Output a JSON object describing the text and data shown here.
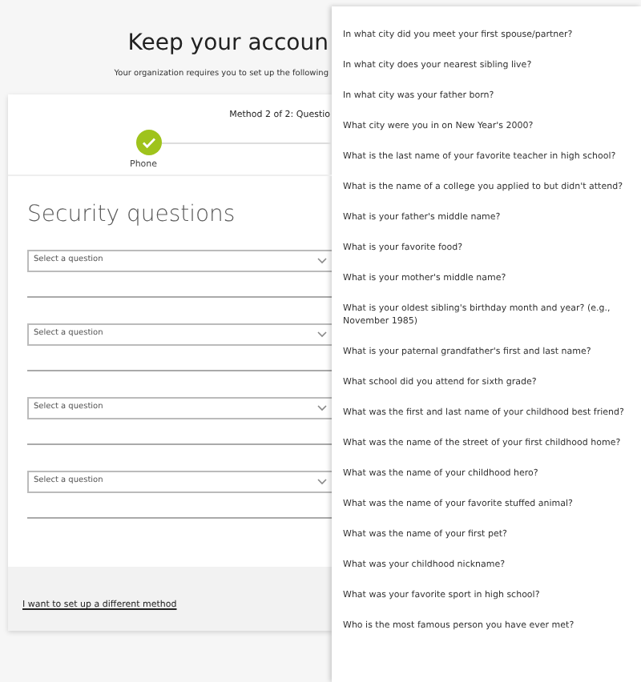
{
  "header": {
    "title": "Keep your accoun",
    "subtitle": "Your organization requires you to set up the following"
  },
  "card": {
    "progress": "Method 2 of 2: Questio",
    "steps": [
      {
        "label": "Phone",
        "completed": true
      }
    ],
    "heading": "Security questions",
    "questions": [
      {
        "placeholder": "Select a question"
      },
      {
        "placeholder": "Select a question"
      },
      {
        "placeholder": "Select a question"
      },
      {
        "placeholder": "Select a question"
      }
    ],
    "footer_link": "I want to set up a different method"
  },
  "dropdown": {
    "options": [
      "In what city did you meet your first spouse/partner?",
      "In what city does your nearest sibling live?",
      "In what city was your father born?",
      "What city were you in on New Year's 2000?",
      "What is the last name of your favorite teacher in high school?",
      "What is the name of a college you applied to but didn't attend?",
      "What is your father's middle name?",
      "What is your favorite food?",
      "What is your mother's middle name?",
      "What is your oldest sibling's birthday month and year? (e.g., November 1985)",
      "What is your paternal grandfather's first and last name?",
      "What school did you attend for sixth grade?",
      "What was the first and last name of your childhood best friend?",
      "What was the name of the street of your first childhood home?",
      "What was the name of your childhood hero?",
      "What was the name of your favorite stuffed animal?",
      "What was the name of your first pet?",
      "What was your childhood nickname?",
      "What was your favorite sport in high school?",
      "Who is the most famous person you have ever met?"
    ]
  }
}
